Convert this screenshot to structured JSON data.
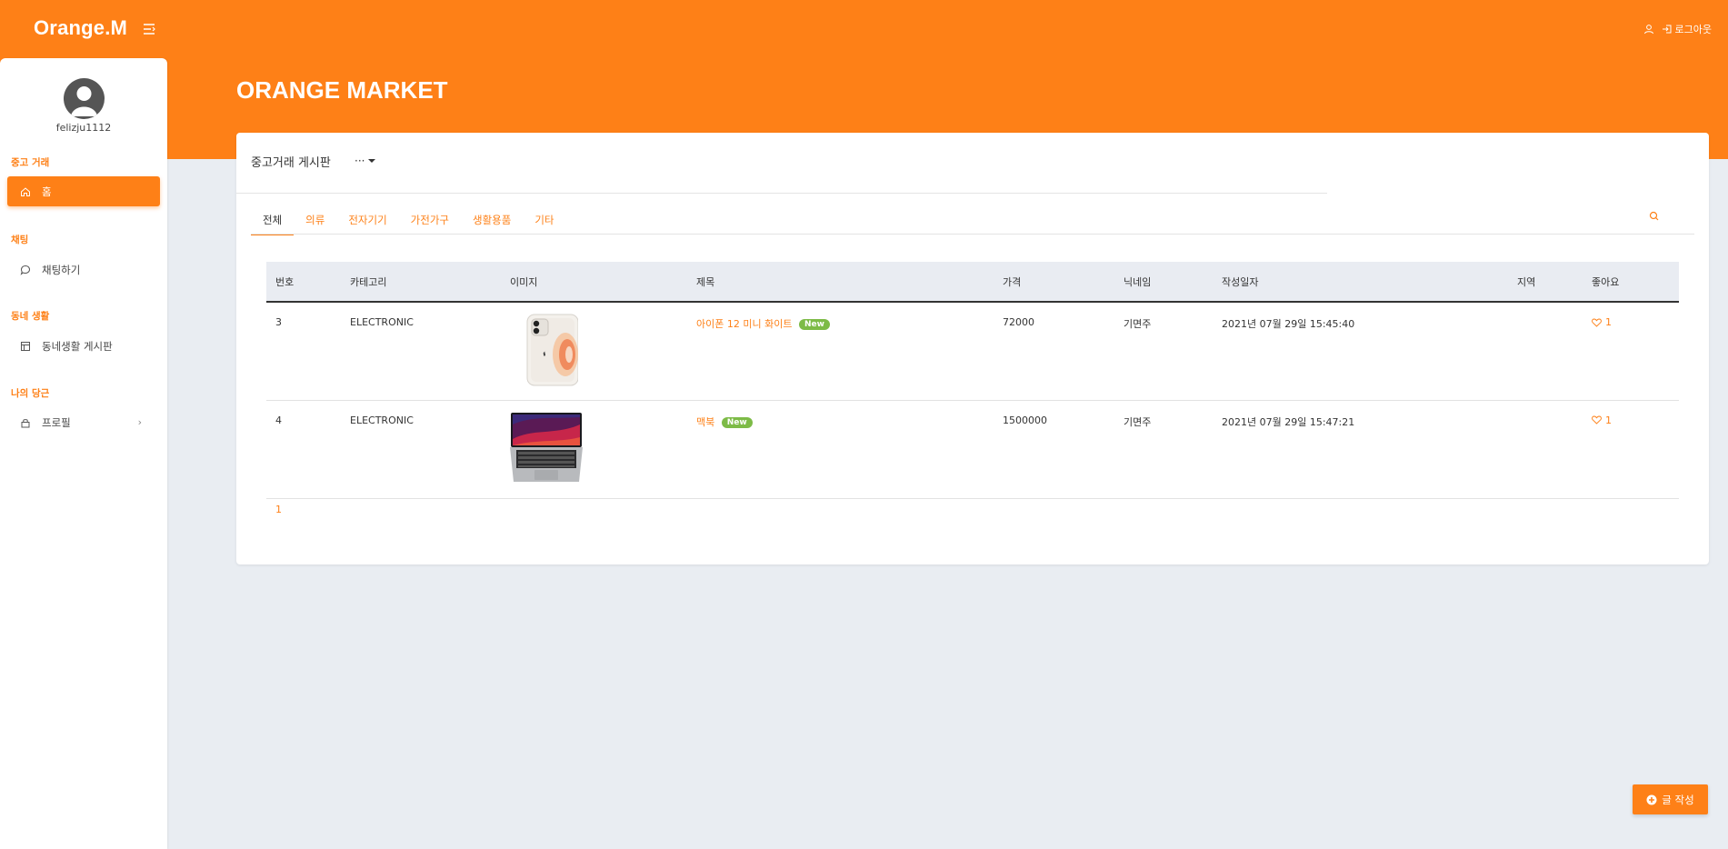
{
  "app": {
    "logo": "Orange.M",
    "page_title": "ORANGE MARKET",
    "logout_label": "로그아웃",
    "accent_color": "#fe8017"
  },
  "sidebar": {
    "username": "felizju1112",
    "sections": [
      {
        "label": "중고 거래",
        "items": [
          {
            "label": "홈",
            "icon": "home-icon",
            "active": true
          }
        ]
      },
      {
        "label": "채팅",
        "items": [
          {
            "label": "채팅하기",
            "icon": "chat-icon"
          }
        ]
      },
      {
        "label": "동네 생활",
        "items": [
          {
            "label": "동네생활 게시판",
            "icon": "board-icon"
          }
        ]
      },
      {
        "label": "나의 당근",
        "items": [
          {
            "label": "프로필",
            "icon": "lock-icon",
            "chevron": "›"
          }
        ]
      }
    ]
  },
  "board": {
    "title": "중고거래 게시판",
    "dots": "···",
    "tabs": [
      "전체",
      "의류",
      "전자기기",
      "가전가구",
      "생활용품",
      "기타"
    ],
    "active_tab": "전체",
    "columns": [
      "번호",
      "카테고리",
      "이미지",
      "제목",
      "가격",
      "닉네임",
      "작성일자",
      "지역",
      "좋아요"
    ],
    "rows": [
      {
        "no": "3",
        "category": "ELECTRONIC",
        "image": "iphone-image",
        "title": "아이폰 12 미니 화이트",
        "badge": "New",
        "price": "72000",
        "nickname": "기면주",
        "date": "2021년 07월 29일 15:45:40",
        "region": "",
        "likes": "1"
      },
      {
        "no": "4",
        "category": "ELECTRONIC",
        "image": "macbook-image",
        "title": "맥북",
        "badge": "New",
        "price": "1500000",
        "nickname": "기면주",
        "date": "2021년 07월 29일 15:47:21",
        "region": "",
        "likes": "1"
      }
    ],
    "page": "1"
  },
  "write_button": {
    "label": "글 작성"
  }
}
